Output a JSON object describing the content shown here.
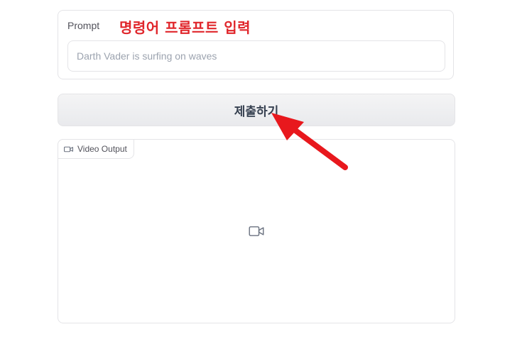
{
  "prompt": {
    "label": "Prompt",
    "placeholder": "Darth Vader is surfing on waves",
    "value": "",
    "annotation": "명령어 프롬프트 입력"
  },
  "submit": {
    "label": "제출하기"
  },
  "video_output": {
    "label": "Video Output",
    "tab_icon": "video-camera-icon",
    "placeholder_icon": "video-camera-icon"
  },
  "colors": {
    "annotation": "#e0262b",
    "arrow": "#e8181d",
    "border": "#e4e4e7",
    "button_text": "#374151"
  }
}
